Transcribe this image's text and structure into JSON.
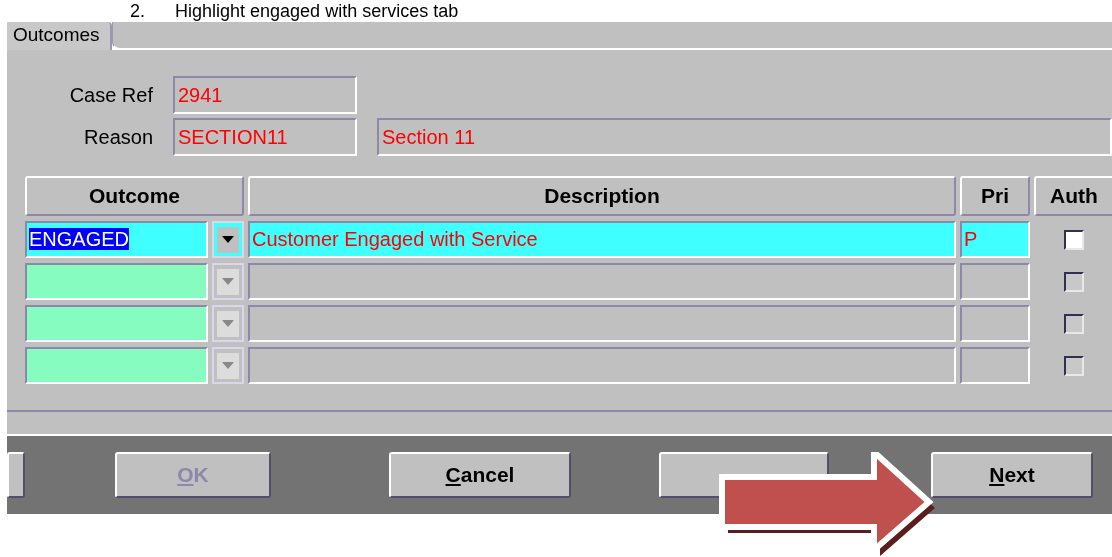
{
  "heading": "2.      Highlight engaged with services tab",
  "tabs": [
    {
      "label": "Outcomes",
      "selected": true
    }
  ],
  "fields": [
    {
      "label": "Case Ref",
      "value": "2941"
    },
    {
      "label": "Reason",
      "value": "SECTION11",
      "description": "Section 11"
    }
  ],
  "table": {
    "columns": [
      "Outcome",
      "Description",
      "Pri",
      "Auth"
    ],
    "rows": [
      {
        "outcome": "ENGAGED",
        "description": "Customer Engaged with Service",
        "pri": "P",
        "auth": false,
        "selected": true
      },
      {
        "auth": false,
        "selected": false
      },
      {
        "auth": false,
        "selected": false
      },
      {
        "auth": false,
        "selected": false
      }
    ]
  },
  "buttons": [
    {
      "kind": "partial"
    },
    {
      "kind": "button",
      "label": [
        {
          "text": "O",
          "underline": true
        },
        {
          "text": "K",
          "underline": false
        }
      ],
      "disabled": true
    },
    {
      "kind": "button",
      "label": [
        {
          "text": "C",
          "underline": true
        },
        {
          "text": "ancel",
          "underline": false
        }
      ],
      "disabled": false
    },
    {
      "kind": "covered"
    },
    {
      "kind": "button",
      "label": [
        {
          "text": "N",
          "underline": true
        },
        {
          "text": "ext",
          "underline": false
        }
      ],
      "disabled": false
    }
  ]
}
